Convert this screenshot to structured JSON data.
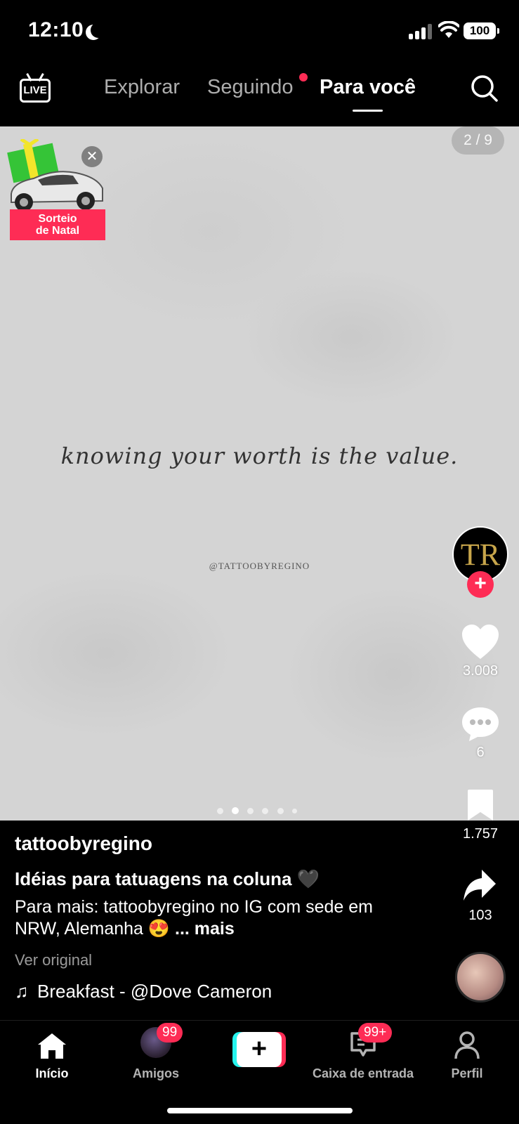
{
  "status_bar": {
    "time": "12:10",
    "battery": "100"
  },
  "top_nav": {
    "live_label": "LIVE",
    "tabs": [
      {
        "label": "Explorar",
        "active": false
      },
      {
        "label": "Seguindo",
        "active": false,
        "has_dot": true
      },
      {
        "label": "Para você",
        "active": true
      }
    ]
  },
  "promo": {
    "label_line1": "Sorteio",
    "label_line2": "de Natal"
  },
  "post": {
    "page_counter": "2 / 9",
    "quote": "knowing your worth is the value.",
    "watermark": "@TATTOOBYREGINO",
    "carousel_total": 6,
    "carousel_active_index": 1,
    "author_avatar_text": "TR",
    "follow_glyph": "+",
    "author": "tattoobyregino",
    "caption_title": "Idéias para tatuagens na coluna 🖤",
    "caption_body": "Para mais: tattoobyregino no IG com sede em NRW, Alemanha 😍",
    "more_label": "... mais",
    "see_original": "Ver original",
    "music": "Breakfast - @Dove Cameron"
  },
  "actions": {
    "likes": "3.008",
    "comments": "6",
    "saves": "1.757",
    "shares": "103"
  },
  "bottom_nav": {
    "home": "Início",
    "friends": "Amigos",
    "friends_badge": "99",
    "create_glyph": "+",
    "inbox": "Caixa de entrada",
    "inbox_badge": "99+",
    "profile": "Perfil"
  },
  "colors": {
    "accent": "#fe2c55",
    "cyan": "#25f4ee",
    "background": "#000000",
    "content_bg": "#d4d4d4"
  }
}
